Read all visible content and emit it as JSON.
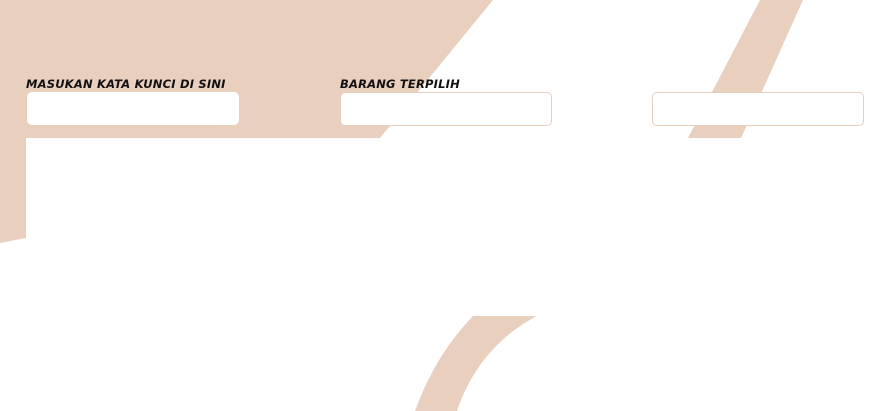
{
  "form": {
    "keyword_field": {
      "label": "MASUKAN KATA KUNCI DI SINI",
      "value": "",
      "placeholder": ""
    },
    "selected_item_field": {
      "label": "BARANG TERPILIH",
      "value": "",
      "placeholder": ""
    },
    "third_field": {
      "label": "",
      "value": "",
      "placeholder": ""
    }
  },
  "colors": {
    "accent_beige": "#e8cfbe",
    "input_border": "#e7cfbf",
    "background": "#ffffff",
    "label_text": "#111111"
  }
}
